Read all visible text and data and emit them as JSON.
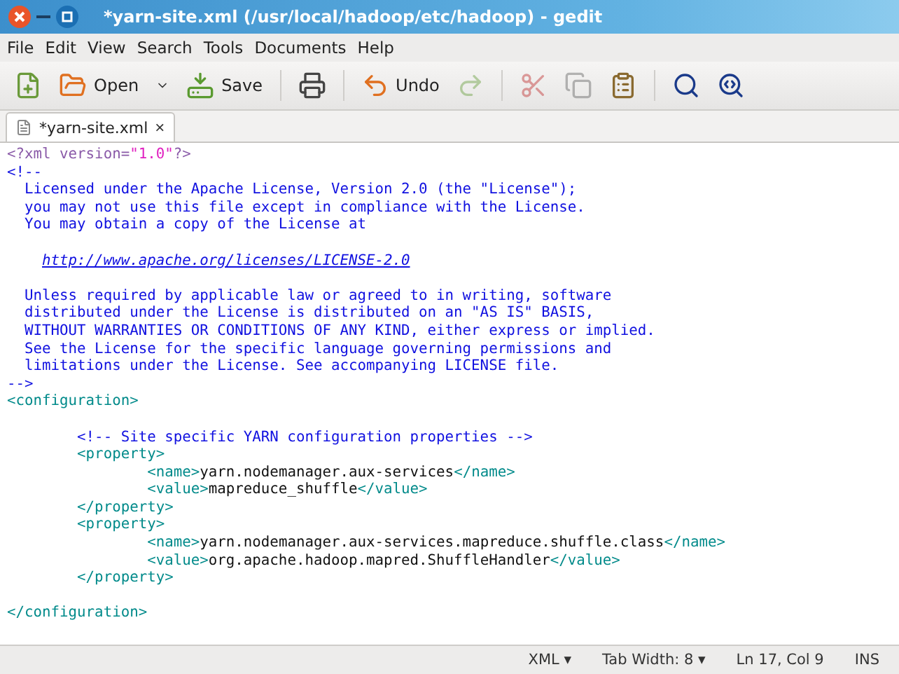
{
  "window": {
    "title": "*yarn-site.xml (/usr/local/hadoop/etc/hadoop) - gedit"
  },
  "menu": [
    "File",
    "Edit",
    "View",
    "Search",
    "Tools",
    "Documents",
    "Help"
  ],
  "toolbar": [
    {
      "kind": "new"
    },
    {
      "kind": "open",
      "label": "Open"
    },
    {
      "kind": "dropdown"
    },
    {
      "kind": "save",
      "label": "Save"
    },
    {
      "kind": "sep"
    },
    {
      "kind": "print"
    },
    {
      "kind": "sep"
    },
    {
      "kind": "undo",
      "label": "Undo"
    },
    {
      "kind": "redo",
      "disabled": true
    },
    {
      "kind": "sep"
    },
    {
      "kind": "cut",
      "disabled": true
    },
    {
      "kind": "copy",
      "disabled": true
    },
    {
      "kind": "paste"
    },
    {
      "kind": "sep"
    },
    {
      "kind": "find"
    },
    {
      "kind": "replace"
    }
  ],
  "tabs": [
    {
      "label": "*yarn-site.xml",
      "selected": true,
      "close": "×"
    }
  ],
  "code": [
    [
      {
        "kind": "pi",
        "text": "<?xml version="
      },
      {
        "kind": "string",
        "text": "\"1.0\""
      },
      {
        "kind": "pi",
        "text": "?>"
      }
    ],
    [
      {
        "kind": "comment",
        "text": "<!--"
      }
    ],
    [
      {
        "kind": "comment",
        "text": "  Licensed under the Apache License, Version 2.0 (the \"License\");"
      }
    ],
    [
      {
        "kind": "comment",
        "text": "  you may not use this file except in compliance with the License."
      }
    ],
    [
      {
        "kind": "comment",
        "text": "  You may obtain a copy of the License at"
      }
    ],
    {
      "kind": "blank"
    },
    {
      "kind": "link",
      "segments": [
        {
          "kind": "link",
          "text": "http://www.apache.org/licenses/LICENSE-2.0"
        }
      ]
    },
    {
      "kind": "blank"
    },
    [
      {
        "kind": "comment",
        "text": "  Unless required by applicable law or agreed to in writing, software"
      }
    ],
    [
      {
        "kind": "comment",
        "text": "  distributed under the License is distributed on an \"AS IS\" BASIS,"
      }
    ],
    [
      {
        "kind": "comment",
        "text": "  WITHOUT WARRANTIES OR CONDITIONS OF ANY KIND, either express or implied."
      }
    ],
    [
      {
        "kind": "comment",
        "text": "  See the License for the specific language governing permissions and"
      }
    ],
    [
      {
        "kind": "comment",
        "text": "  limitations under the License. See accompanying LICENSE file."
      }
    ],
    [
      {
        "kind": "comment",
        "text": "-->"
      }
    ],
    [
      {
        "kind": "tag",
        "text": "<configuration>"
      }
    ],
    {
      "kind": "blank"
    },
    [
      {
        "kind": "comment",
        "text": "        <!-- Site specific YARN configuration properties -->"
      }
    ],
    [
      {
        "kind": "tag",
        "text": "        <property>"
      }
    ],
    [
      {
        "kind": "tag",
        "text": "                <name>"
      },
      {
        "kind": "text",
        "text": "yarn.nodemanager.aux-services"
      },
      {
        "kind": "tag",
        "text": "</name>"
      }
    ],
    [
      {
        "kind": "tag",
        "text": "                <value>"
      },
      {
        "kind": "text",
        "text": "mapreduce_shuffle"
      },
      {
        "kind": "tag",
        "text": "</value>"
      }
    ],
    [
      {
        "kind": "tag",
        "text": "        </property>"
      }
    ],
    [
      {
        "kind": "tag",
        "text": "        <property>"
      }
    ],
    [
      {
        "kind": "tag",
        "text": "                <name>"
      },
      {
        "kind": "text",
        "text": "yarn.nodemanager.aux-services.mapreduce.shuffle.class"
      },
      {
        "kind": "tag",
        "text": "</name>"
      }
    ],
    [
      {
        "kind": "tag",
        "text": "                <value>"
      },
      {
        "kind": "text",
        "text": "org.apache.hadoop.mapred.ShuffleHandler"
      },
      {
        "kind": "tag",
        "text": "</value>"
      }
    ],
    [
      {
        "kind": "tag",
        "text": "        </property>"
      }
    ],
    {
      "kind": "blank"
    },
    [
      {
        "kind": "tag",
        "text": "</configuration>"
      }
    ]
  ],
  "status_bar": [
    {
      "kind": "dropdown",
      "text": "XML",
      "caret": "▾"
    },
    {
      "kind": "dropdown",
      "text": "Tab Width: 8",
      "caret": "▾"
    },
    {
      "kind": "text",
      "text": "Ln 17, Col 9"
    },
    {
      "kind": "text",
      "text": "INS"
    }
  ]
}
